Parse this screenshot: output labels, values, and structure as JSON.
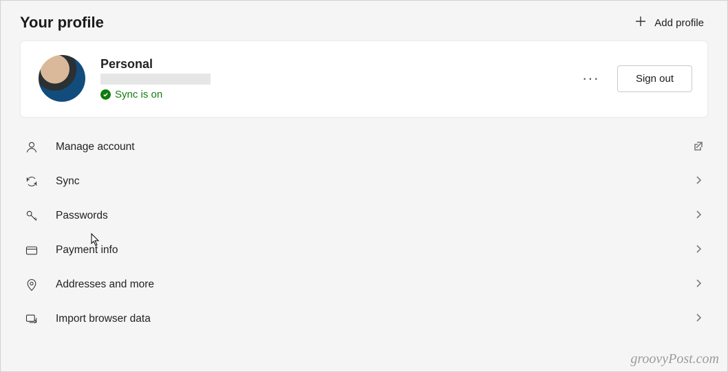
{
  "page": {
    "title": "Your profile",
    "add_profile": "Add profile"
  },
  "profile": {
    "name": "Personal",
    "sync_status": "Sync is on",
    "sign_out": "Sign out"
  },
  "items": [
    {
      "id": "manage-account",
      "label": "Manage account",
      "icon": "person",
      "external": true
    },
    {
      "id": "sync",
      "label": "Sync",
      "icon": "refresh",
      "external": false
    },
    {
      "id": "passwords",
      "label": "Passwords",
      "icon": "key",
      "external": false
    },
    {
      "id": "payment-info",
      "label": "Payment info",
      "icon": "card",
      "external": false
    },
    {
      "id": "addresses",
      "label": "Addresses and more",
      "icon": "pin",
      "external": false
    },
    {
      "id": "import-data",
      "label": "Import browser data",
      "icon": "import",
      "external": false
    }
  ],
  "watermark": "groovyPost.com"
}
